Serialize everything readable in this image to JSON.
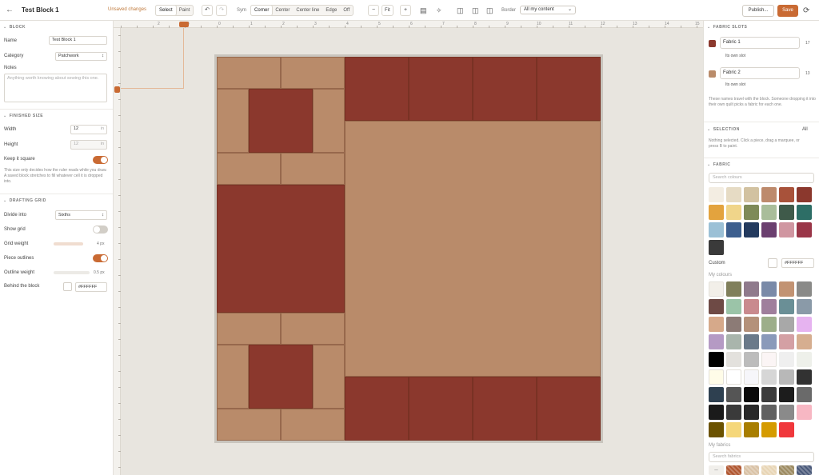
{
  "header": {
    "back_icon": "arrow-left-icon",
    "title": "Test Block 1",
    "status": "Unsaved changes",
    "mode_tabs": [
      "Select",
      "Paint"
    ],
    "symmetry_label": "Sym",
    "symmetry_tabs": [
      "Corner",
      "Center",
      "Center line",
      "Edge",
      "Off"
    ],
    "zoom_fit": "Fit",
    "border_label": "Border",
    "border_value": "All my content",
    "publish_label": "Publish...",
    "save_label": "Save"
  },
  "left": {
    "block_title": "BLOCK",
    "name_label": "Name",
    "name_value": "Test Block 1",
    "category_label": "Category",
    "category_value": "Patchwork",
    "notes_label": "Notes",
    "notes_placeholder": "Anything worth knowing about sewing this one.",
    "finished_title": "FINISHED SIZE",
    "width_label": "Width",
    "width_value": "12",
    "width_unit": "in",
    "height_label": "Height",
    "height_value": "12",
    "height_unit": "in",
    "keep_square_label": "Keep it square",
    "finished_help": "This size only decides how the ruler reads while you draw. A saved block stretches to fill whatever cell it is dropped into.",
    "grid_title": "DRAFTING GRID",
    "divide_label": "Divide into",
    "divide_value": "Sixths",
    "show_grid_label": "Show grid",
    "grid_weight_label": "Grid weight",
    "grid_weight_value": "4 px",
    "piece_outlines_label": "Piece outlines",
    "outline_weight_label": "Outline weight",
    "outline_weight_value": "0.5 px",
    "behind_label": "Behind the block",
    "behind_value": "#FFFFFF"
  },
  "ruler": {
    "top": [
      "2",
      "4",
      "1",
      "0",
      "1",
      "2",
      "3",
      "4",
      "5",
      "6",
      "7",
      "8",
      "9",
      "10",
      "11",
      "12",
      "13",
      "14",
      "15"
    ]
  },
  "right": {
    "slots_title": "FABRIC SLOTS",
    "slot1_name": "Fabric 1",
    "slot1_count": "17",
    "slot1_sub": "Its own slot",
    "slot1_color": "#8b382d",
    "slot2_name": "Fabric 2",
    "slot2_count": "13",
    "slot2_sub": "Its own slot",
    "slot2_color": "#b98b6a",
    "slots_help": "These names travel with the block. Someone dropping it into their own quilt picks a fabric for each one.",
    "selection_title": "SELECTION",
    "selection_all": "All",
    "selection_help": "Nothing selected. Click a piece, drag a marquee, or press B to paint.",
    "fabric_title": "FABRIC",
    "search_colours": "Search colours",
    "custom_label": "Custom",
    "custom_value": "#FFFFFF",
    "my_colours_label": "My colours",
    "my_fabrics_label": "My fabrics",
    "search_fabrics": "Search fabrics"
  },
  "palette": [
    "#f3ede2",
    "#e6dbc4",
    "#d2c2a1",
    "#bd8a6c",
    "#a8523a",
    "#8b382d",
    "#e3a33e",
    "#f0d58a",
    "#7e8a58",
    "#a9bd9a",
    "#3f5a4a",
    "#2d6e66",
    "#9bc0d6",
    "#3c5e8e",
    "#233a5e",
    "#6b3f6f",
    "#d096a1",
    "#9a3648",
    "#3a3a3a"
  ],
  "my_colours": [
    "#f2efe9",
    "#807f5b",
    "#8f7a8c",
    "#7a8aa8",
    "#c29373",
    "#8a8a88",
    "#6e4a45",
    "#9bc4a8",
    "#c98a8e",
    "#9f7f9c",
    "#6a8f96",
    "#8a9aa8",
    "#d6a98a",
    "#8c7b76",
    "#b4917a",
    "#9dae8a",
    "#a8a8a8",
    "#e6b3f0",
    "#b59ac4",
    "#a9b5ac",
    "#6a7a8a",
    "#8a9aba",
    "#d4a0a4",
    "#d6ae90",
    "#000000",
    "#e3e1dd",
    "#bcbcbc",
    "#fbf5f5",
    "#efefef",
    "#eef0ea",
    "#fffce8",
    "#ffffff",
    "#f6f6fa",
    "#d6d6d6",
    "#b8b8b8",
    "#323232",
    "#2e4050",
    "#555555",
    "#0a0a0a",
    "#3c3c3c",
    "#1c1c1c",
    "#6a6a6a",
    "#1a1a1a",
    "#3a3a3a",
    "#282828",
    "#606060",
    "#8a8a8a",
    "#f7b7c3",
    "#6b5200",
    "#f5d77a",
    "#a87e00",
    "#d59b00",
    "#f0383c"
  ],
  "fabrics": [
    "#b0562f",
    "#d9c2a6",
    "#e8d5b5",
    "#9c8a60",
    "#4b5a7a"
  ]
}
